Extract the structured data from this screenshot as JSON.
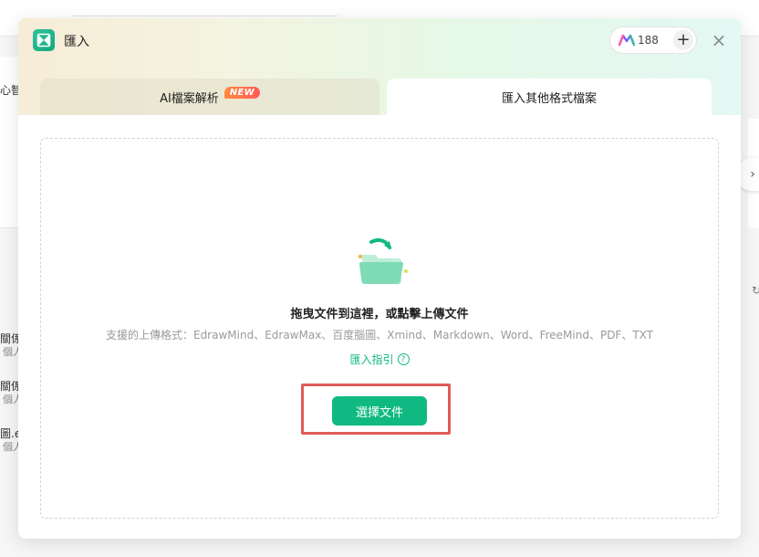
{
  "background": {
    "left_labels": [
      {
        "title": "心智",
        "sub": ""
      },
      {
        "title": "關係",
        "sub": "個人"
      },
      {
        "title": "關係",
        "sub": "個人"
      },
      {
        "title": "圖.e.",
        "sub": "個人"
      }
    ],
    "right_arrow": "›"
  },
  "modal": {
    "title": "匯入",
    "credits": "188",
    "add_symbol": "+",
    "close_symbol": "×",
    "tabs": [
      {
        "label": "AI檔案解析",
        "badge": "NEW"
      },
      {
        "label": "匯入其他格式檔案"
      }
    ],
    "drop_zone": {
      "title": "拖曳文件到這裡，或點擊上傳文件",
      "formats": "支援的上傳格式：EdrawMind、EdrawMax、百度腦圖、Xmind、Markdown、Word、FreeMind、PDF、TXT",
      "guide_link": "匯入指引",
      "help_symbol": "?",
      "button": "選擇文件"
    }
  },
  "icons": {
    "logo": "mindmaster-logo-icon",
    "credit": "m-credit-icon",
    "folder": "folder-upload-icon"
  },
  "colors": {
    "accent": "#10b981",
    "highlight": "#e35a5a",
    "badge": "#ff6b47"
  }
}
